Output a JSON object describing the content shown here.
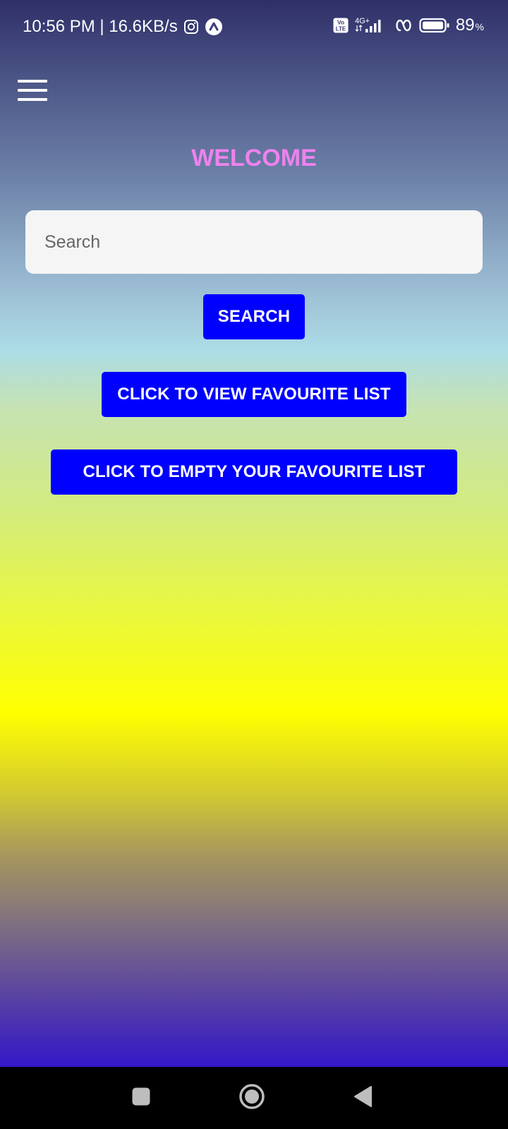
{
  "status_bar": {
    "time_info": "10:56 PM | 16.6KB/s",
    "network_type": "4G+",
    "volte_top": "Vo",
    "volte_bottom": "LTE",
    "battery_value": "89",
    "battery_symbol": "%"
  },
  "header": {
    "title": "WELCOME"
  },
  "search": {
    "placeholder": "Search",
    "value": ""
  },
  "buttons": {
    "search_label": "SEARCH",
    "view_favourites_label": "CLICK TO VIEW FAVOURITE LIST",
    "empty_favourites_label": "CLICK TO EMPTY YOUR FAVOURITE LIST"
  },
  "colors": {
    "title": "#ee82ee",
    "button_bg": "#0000ff",
    "button_text": "#ffffff",
    "input_bg": "#f5f5f5",
    "nav_bar_bg": "#000000"
  },
  "icons": {
    "menu": "hamburger-menu-icon",
    "instagram": "instagram-icon",
    "app_notification": "a-circle-icon",
    "volte": "volte-icon",
    "signal": "signal-strength-icon",
    "data_saver": "loop-icon",
    "battery": "battery-icon",
    "recents": "square-icon",
    "home": "circle-icon",
    "back": "triangle-back-icon"
  }
}
